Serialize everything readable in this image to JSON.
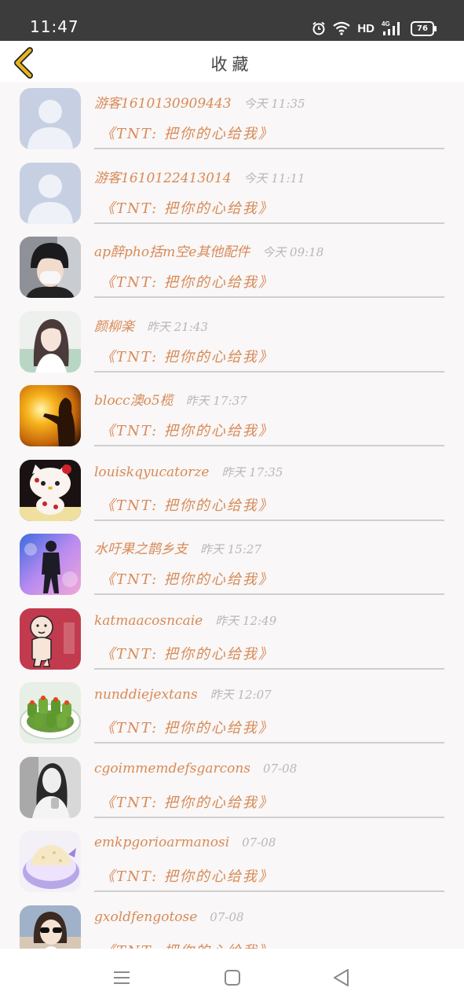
{
  "status_bar": {
    "time": "11:47",
    "network": "HD",
    "signal_label": "4G",
    "battery": "76"
  },
  "header": {
    "title": "收藏"
  },
  "favorites": [
    {
      "name": "游客1610130909443",
      "time": "今天 11:35",
      "title": "《TNT: 把你的心给我》",
      "avatar": "default-avatar"
    },
    {
      "name": "游客1610122413014",
      "time": "今天 11:11",
      "title": "《TNT: 把你的心给我》",
      "avatar": "default-avatar"
    },
    {
      "name": "ap醉pho括m空e其他配件",
      "time": "今天 09:18",
      "title": "《TNT: 把你的心给我》",
      "avatar": "boy-mask-photo"
    },
    {
      "name": "颜柳楽",
      "time": "昨天 21:43",
      "title": "《TNT: 把你的心给我》",
      "avatar": "girl-photo"
    },
    {
      "name": "blocc澳o5榄",
      "time": "昨天 17:37",
      "title": "《TNT: 把你的心给我》",
      "avatar": "sunset-silhouette"
    },
    {
      "name": "louiskqyucatorze",
      "time": "昨天 17:35",
      "title": "《TNT: 把你的心给我》",
      "avatar": "hello-kitty"
    },
    {
      "name": "水吁果之鹊乡支",
      "time": "昨天 15:27",
      "title": "《TNT: 把你的心给我》",
      "avatar": "person-colorful-bg"
    },
    {
      "name": "katmaacosncaie",
      "time": "昨天 12:49",
      "title": "《TNT: 把你的心给我》",
      "avatar": "cartoon-baby-sticker"
    },
    {
      "name": "nunddiejextans",
      "time": "昨天 12:07",
      "title": "《TNT: 把你的心给我》",
      "avatar": "food-cucumber-rolls"
    },
    {
      "name": "cgoimmemdefsgarcons",
      "time": "07-08",
      "title": "《TNT: 把你的心给我》",
      "avatar": "bw-portrait"
    },
    {
      "name": "emkpgorioarmanosi",
      "time": "07-08",
      "title": "《TNT: 把你的心给我》",
      "avatar": "rice-bowl"
    },
    {
      "name": "gxoldfengotose",
      "time": "07-08",
      "title": "《TNT: 把你的心给我》",
      "avatar": "girl-sunglasses"
    }
  ],
  "colors": {
    "accent": "#d88a57",
    "time": "#b8b8b8",
    "back_arrow": "#e8b420",
    "status_bar": "#3c3c3c"
  }
}
